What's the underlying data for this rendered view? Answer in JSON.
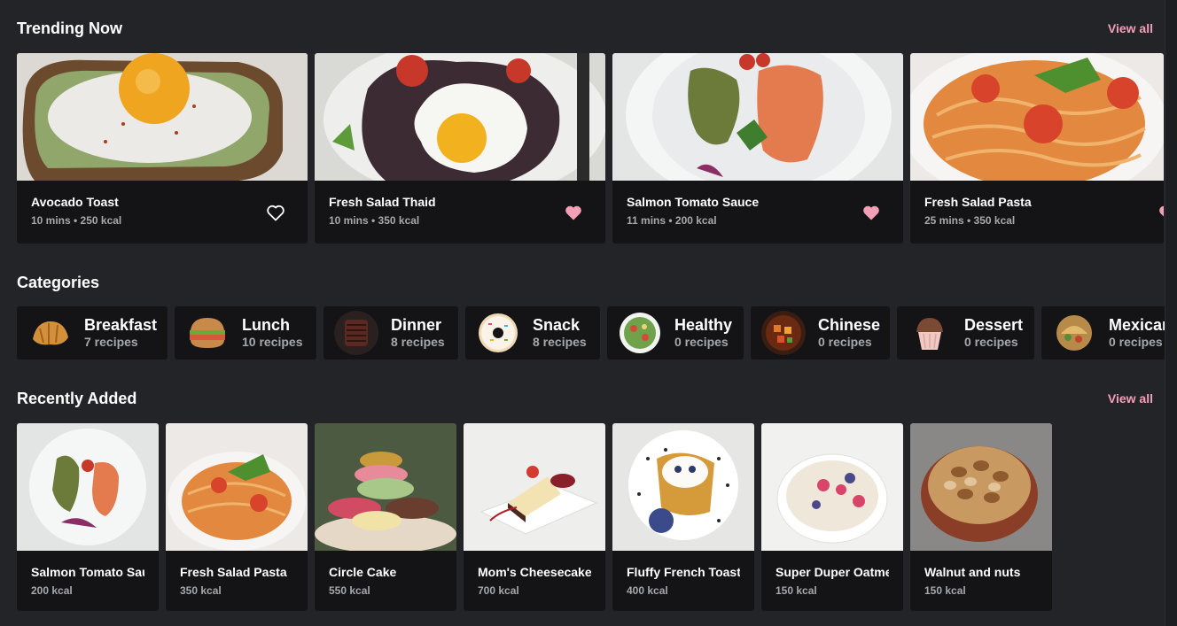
{
  "trending": {
    "title": "Trending Now",
    "view_all": "View all",
    "cards": [
      {
        "name": "Avocado Toast",
        "meta": "10 mins • 250 kcal",
        "liked": false
      },
      {
        "name": "Fresh Salad Thaid",
        "meta": "10 mins • 350 kcal",
        "liked": true
      },
      {
        "name": "Salmon Tomato Sauce",
        "meta": "11 mins • 200 kcal",
        "liked": true
      },
      {
        "name": "Fresh Salad Pasta",
        "meta": "25 mins • 350 kcal",
        "liked": true
      }
    ]
  },
  "categories": {
    "title": "Categories",
    "items": [
      {
        "name": "Breakfast",
        "count": "7 recipes"
      },
      {
        "name": "Lunch",
        "count": "10 recipes"
      },
      {
        "name": "Dinner",
        "count": "8 recipes"
      },
      {
        "name": "Snack",
        "count": "8 recipes"
      },
      {
        "name": "Healthy",
        "count": "0 recipes"
      },
      {
        "name": "Chinese",
        "count": "0 recipes"
      },
      {
        "name": "Dessert",
        "count": "0 recipes"
      },
      {
        "name": "Mexican",
        "count": "0 recipes"
      }
    ]
  },
  "recent": {
    "title": "Recently Added",
    "view_all": "View all",
    "cards": [
      {
        "name": "Salmon Tomato Sauce",
        "meta": "200 kcal"
      },
      {
        "name": "Fresh Salad Pasta",
        "meta": "350 kcal"
      },
      {
        "name": "Circle Cake",
        "meta": "550 kcal"
      },
      {
        "name": "Mom's Cheesecake",
        "meta": "700 kcal"
      },
      {
        "name": "Fluffy French Toast",
        "meta": "400 kcal"
      },
      {
        "name": "Super Duper Oatmeal",
        "meta": "150 kcal"
      },
      {
        "name": "Walnut and nuts",
        "meta": "150 kcal"
      }
    ]
  },
  "colors": {
    "background": "#232428",
    "card": "#141416",
    "accent_pink": "#f3a0b6",
    "muted_text": "#a7a8ad"
  },
  "icons": {
    "like_outline": "heart-outline-icon",
    "like_filled": "heart-filled-icon"
  }
}
